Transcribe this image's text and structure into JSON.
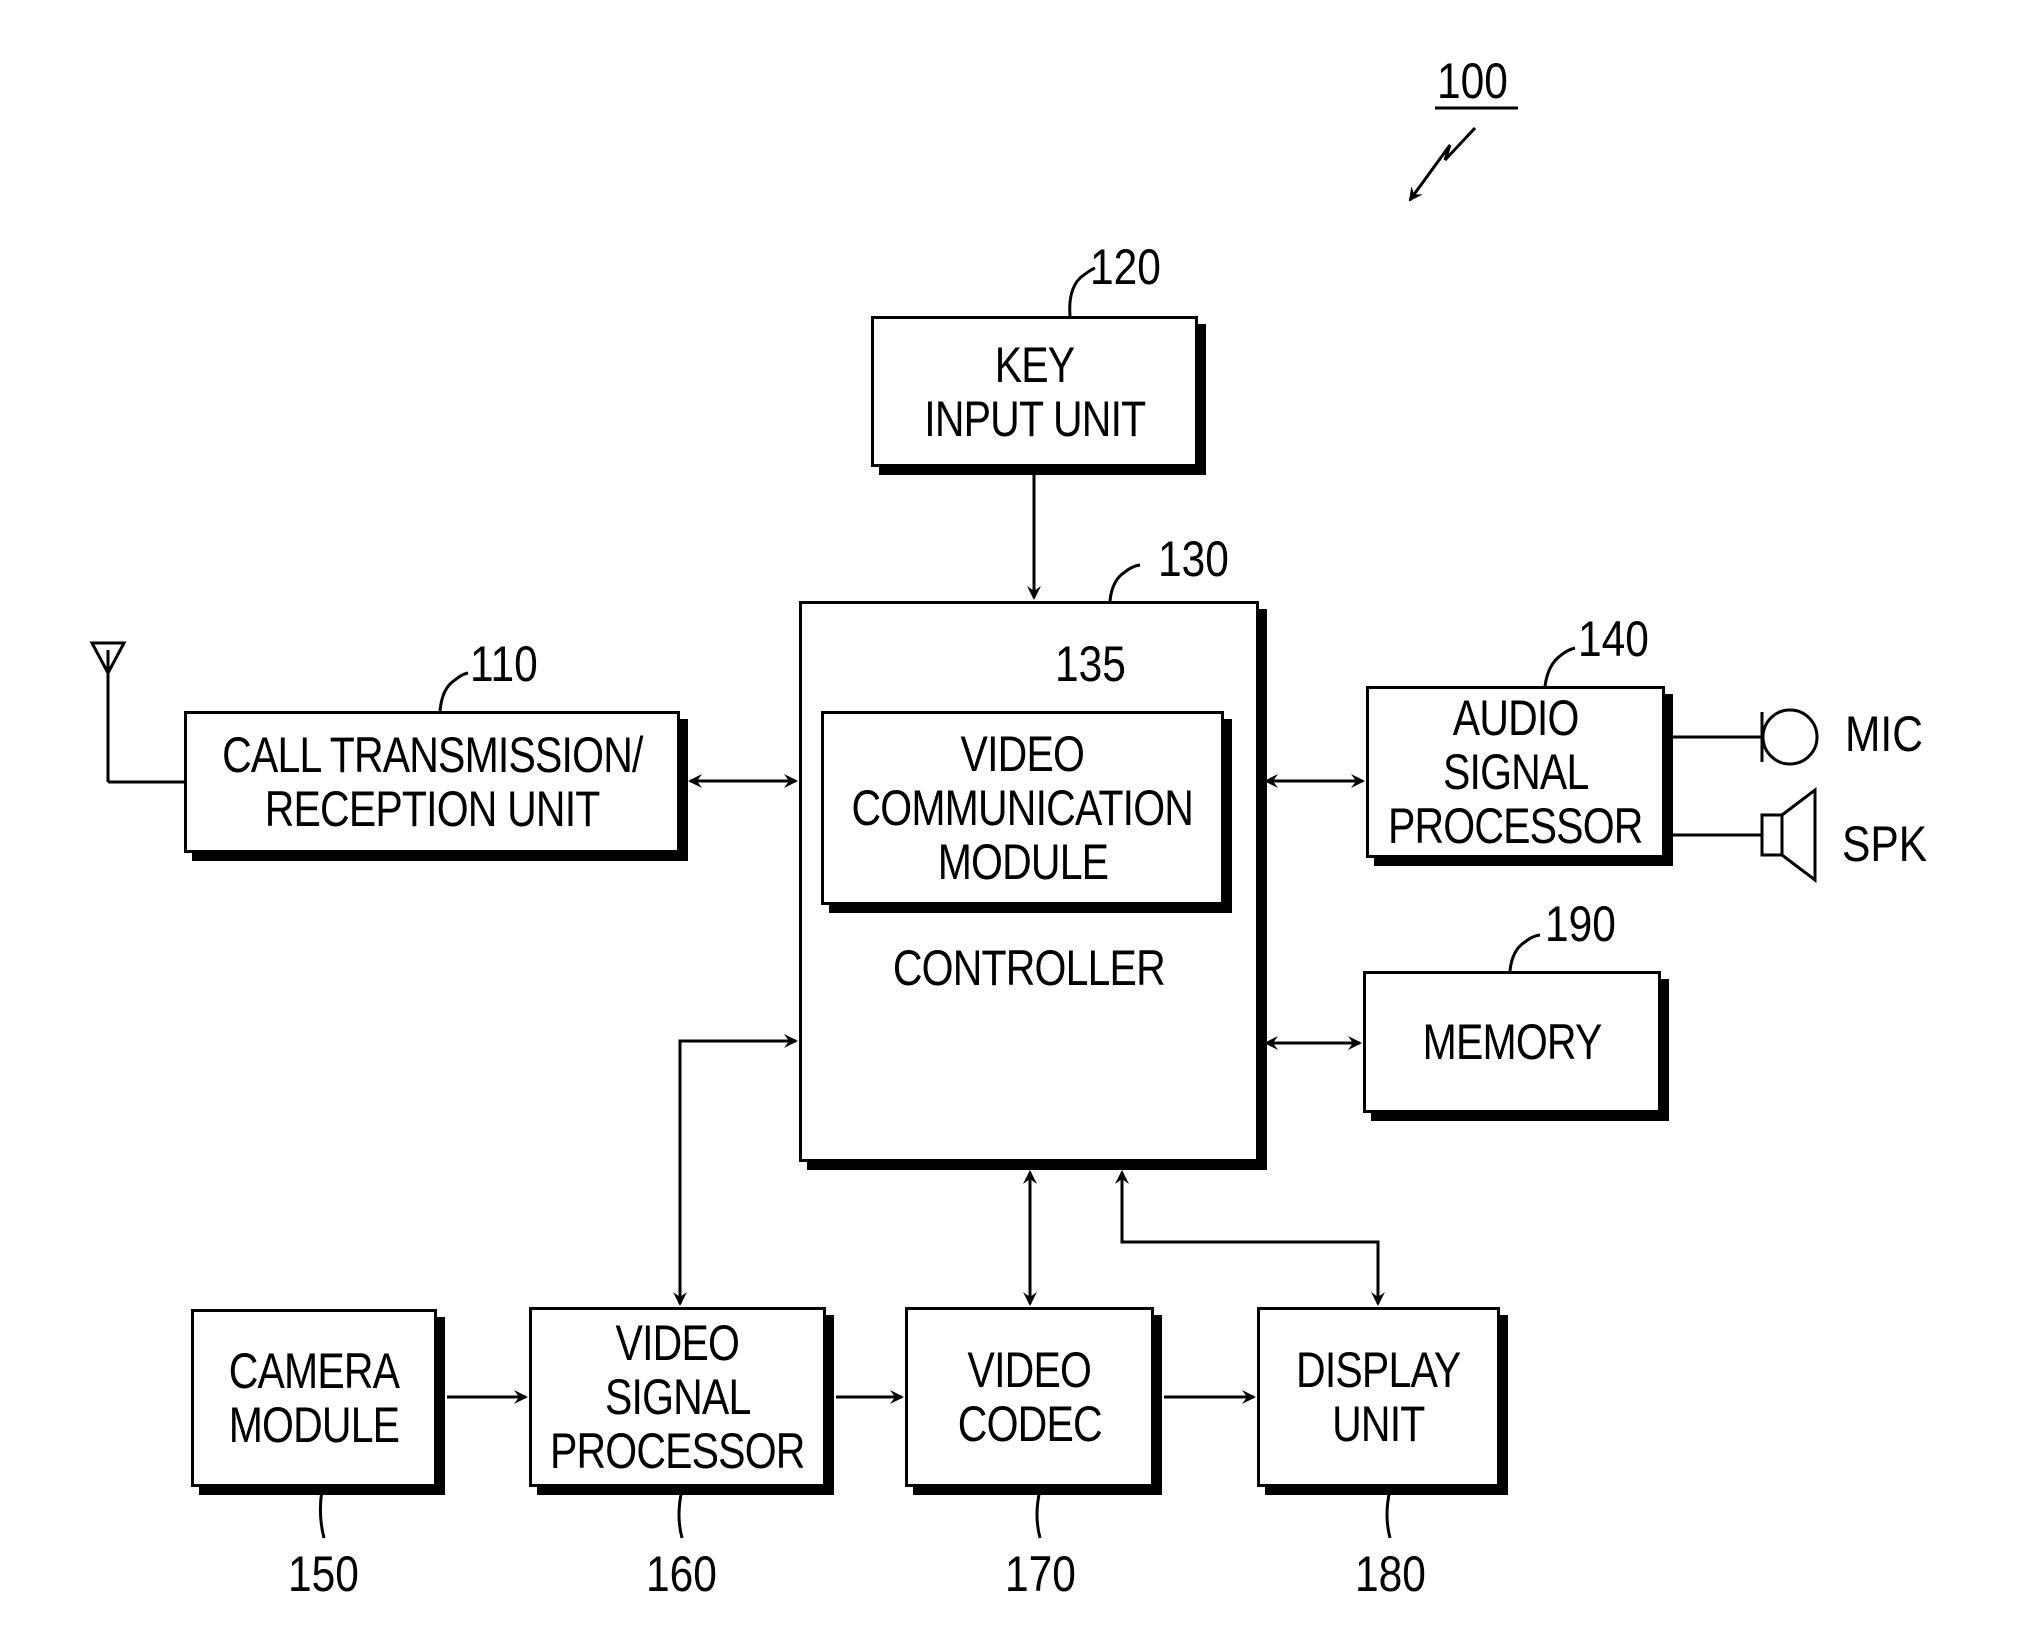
{
  "figure_ref": "100",
  "blocks": {
    "call": {
      "ref": "110",
      "lines": [
        "CALL TRANSMISSION/",
        "RECEPTION UNIT"
      ]
    },
    "key": {
      "ref": "120",
      "lines": [
        "KEY",
        "INPUT UNIT"
      ]
    },
    "controller": {
      "ref": "130",
      "lines": [
        "CONTROLLER"
      ]
    },
    "vcm": {
      "ref": "135",
      "lines": [
        "VIDEO",
        "COMMUNICATION",
        "MODULE"
      ]
    },
    "audio": {
      "ref": "140",
      "lines": [
        "AUDIO",
        "SIGNAL",
        "PROCESSOR"
      ]
    },
    "camera": {
      "ref": "150",
      "lines": [
        "CAMERA",
        "MODULE"
      ]
    },
    "vsp": {
      "ref": "160",
      "lines": [
        "VIDEO",
        "SIGNAL",
        "PROCESSOR"
      ]
    },
    "codec": {
      "ref": "170",
      "lines": [
        "VIDEO",
        "CODEC"
      ]
    },
    "display": {
      "ref": "180",
      "lines": [
        "DISPLAY",
        "UNIT"
      ]
    },
    "memory": {
      "ref": "190",
      "lines": [
        "MEMORY"
      ]
    }
  },
  "peripherals": {
    "mic": "MIC",
    "spk": "SPK"
  }
}
